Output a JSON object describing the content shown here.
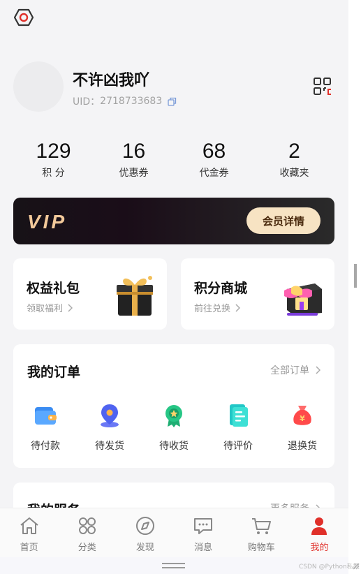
{
  "profile": {
    "username": "不许凶我吖",
    "uid_label": "UID：",
    "uid": "2718733683"
  },
  "stats": [
    {
      "value": "129",
      "label": "积 分"
    },
    {
      "value": "16",
      "label": "优惠券"
    },
    {
      "value": "68",
      "label": "代金券"
    },
    {
      "value": "2",
      "label": "收藏夹"
    }
  ],
  "vip": {
    "logo": "VIP",
    "detail_label": "会员详情"
  },
  "promos": [
    {
      "title": "权益礼包",
      "subtitle": "领取福利",
      "icon": "gift-box-icon"
    },
    {
      "title": "积分商城",
      "subtitle": "前往兑换",
      "icon": "shop-icon"
    }
  ],
  "orders": {
    "title": "我的订单",
    "all_label": "全部订单",
    "items": [
      {
        "label": "待付款",
        "icon": "wallet-icon"
      },
      {
        "label": "待发货",
        "icon": "location-pin-icon"
      },
      {
        "label": "待收货",
        "icon": "medal-icon"
      },
      {
        "label": "待评价",
        "icon": "document-icon"
      },
      {
        "label": "退换货",
        "icon": "money-bag-icon"
      }
    ]
  },
  "services": {
    "title": "我的服务",
    "more_label": "更多服务"
  },
  "tabbar": {
    "active_color": "#e0302a",
    "items": [
      {
        "label": "首页",
        "icon": "home-icon"
      },
      {
        "label": "分类",
        "icon": "category-icon"
      },
      {
        "label": "发现",
        "icon": "compass-icon"
      },
      {
        "label": "消息",
        "icon": "message-icon"
      },
      {
        "label": "购物车",
        "icon": "cart-icon"
      },
      {
        "label": "我的",
        "icon": "user-icon",
        "active": true
      }
    ]
  },
  "watermark": "CSDN @Python私教"
}
